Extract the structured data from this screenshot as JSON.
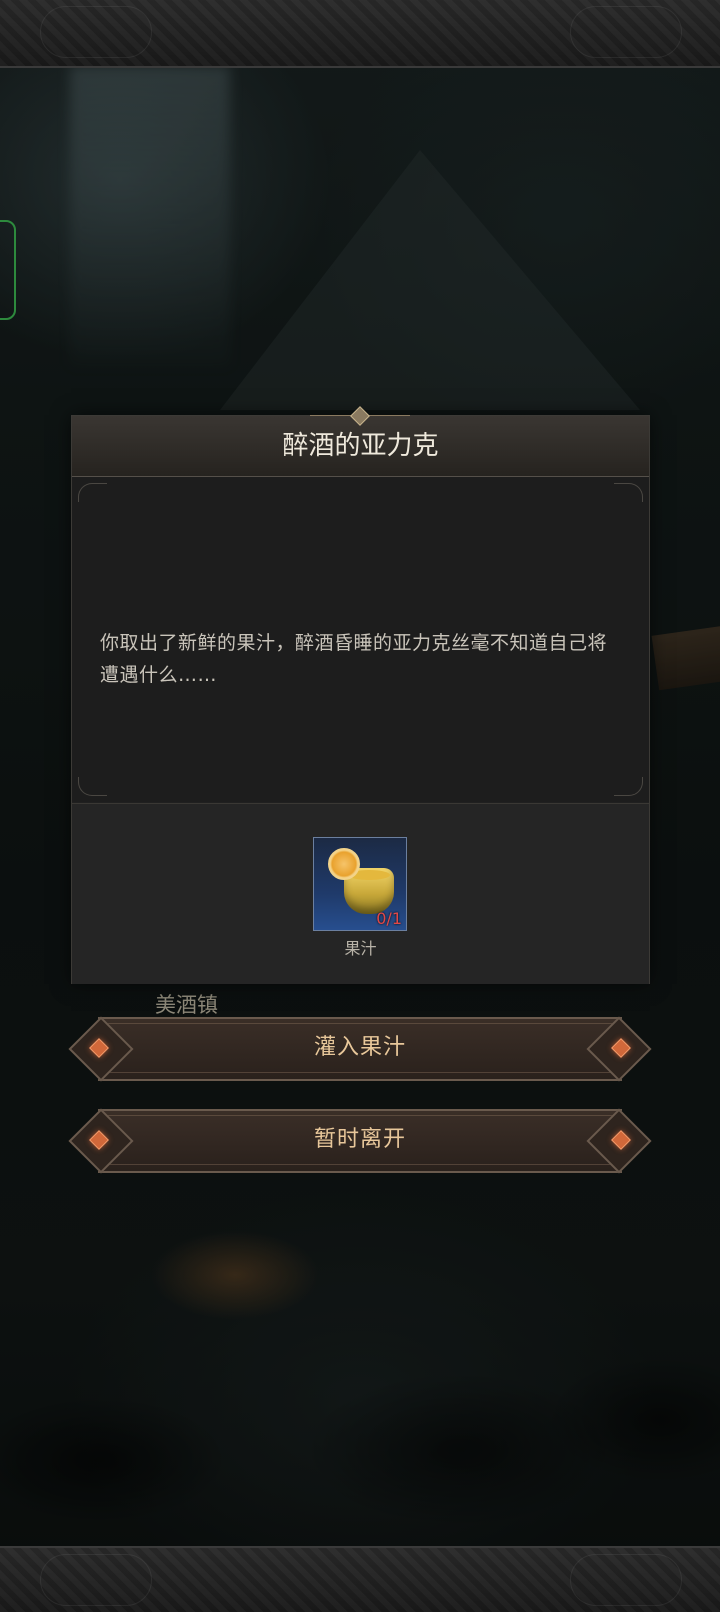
{
  "dialog": {
    "title": "醉酒的亚力克",
    "text": "你取出了新鲜的果汁，醉酒昏睡的亚力克丝毫不知道自己将遭遇什么……",
    "item": {
      "name": "果汁",
      "count": "0/1",
      "icon": "juice-cup-icon"
    }
  },
  "map": {
    "location_label": "美酒镇"
  },
  "actions": {
    "primary_label": "灌入果汁",
    "secondary_label": "暂时离开"
  },
  "colors": {
    "accent_text": "#e8c79a",
    "count_red": "#e04848",
    "side_tab_green": "#3fbf55",
    "gem_orange": "#d1683a"
  }
}
